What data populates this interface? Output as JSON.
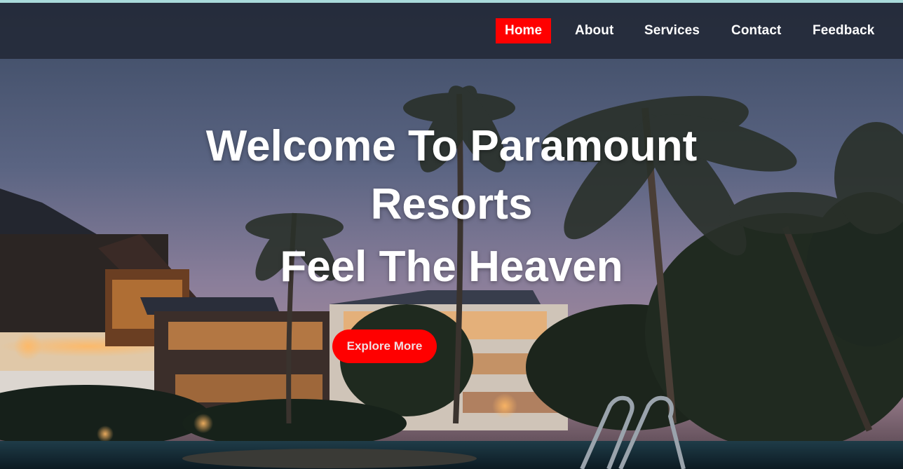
{
  "nav": {
    "items": [
      {
        "label": "Home",
        "active": true
      },
      {
        "label": "About",
        "active": false
      },
      {
        "label": "Services",
        "active": false
      },
      {
        "label": "Contact",
        "active": false
      },
      {
        "label": "Feedback",
        "active": false
      }
    ]
  },
  "hero": {
    "title_line1": "Welcome To Paramount",
    "title_line2": "Resorts",
    "subtitle": "Feel The Heaven",
    "cta_label": "Explore More"
  },
  "colors": {
    "accent": "#ff0000",
    "navbar_bg": "#222836",
    "text": "#ffffff"
  }
}
